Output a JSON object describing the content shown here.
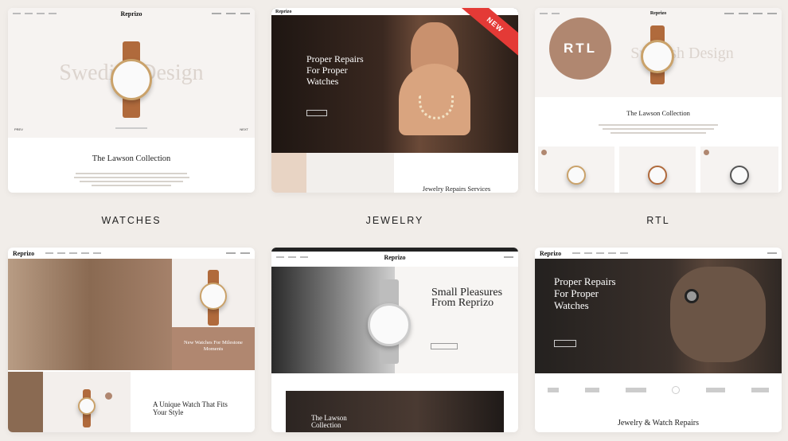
{
  "cards": {
    "watches": {
      "caption": "WATCHES",
      "logo": "Reprizo",
      "hero_text": "Swedish Design",
      "collection_title": "The Lawson Collection",
      "prev": "PREV",
      "next": "NEXT"
    },
    "jewelry": {
      "caption": "JEWELRY",
      "logo": "Reprizo",
      "badge": "NEW",
      "hero_title": "Proper Repairs For Proper Watches",
      "section_title": "Jewelry Repairs Services"
    },
    "rtl": {
      "caption": "RTL",
      "logo": "Reprizo",
      "badge": "RTL",
      "hero_text": "Swedish Design",
      "collection_title": "The Lawson Collection"
    },
    "home4": {
      "logo": "Reprizo",
      "promo_title": "New Watches For Milestone Moments",
      "feature_title": "A Unique Watch That Fits Your Style"
    },
    "home5": {
      "logo": "Reprizo",
      "hero_title": "Small Pleasures From Reprizo",
      "collection_title": "The Lawson Collection"
    },
    "home6": {
      "logo": "Reprizo",
      "hero_title": "Proper Repairs For Proper Watches",
      "section_title": "Jewelry & Watch Repairs"
    }
  },
  "colors": {
    "background": "#f1ede9",
    "accent": "#b08770",
    "ribbon": "#e43a36"
  }
}
